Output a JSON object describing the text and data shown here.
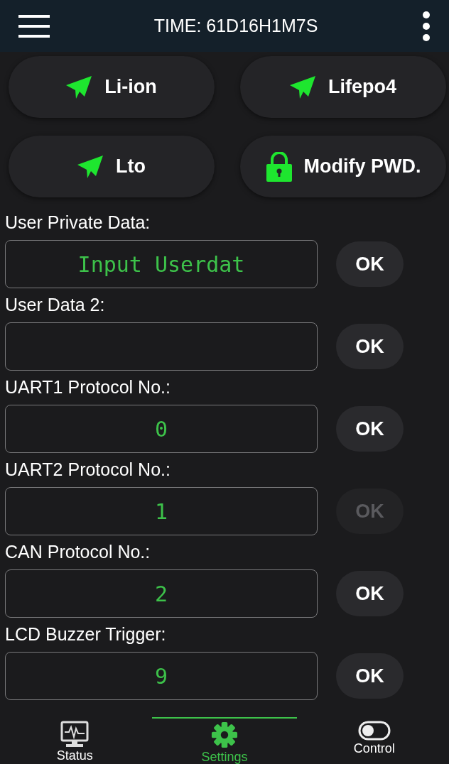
{
  "header": {
    "title": "TIME: 61D16H1M7S"
  },
  "presets": [
    {
      "label": "Li-ion",
      "kind": "plane"
    },
    {
      "label": "Lifepo4",
      "kind": "plane"
    },
    {
      "label": "Lto",
      "kind": "plane"
    },
    {
      "label": "Modify PWD.",
      "kind": "lock"
    }
  ],
  "settings": [
    {
      "label": "User Private Data:",
      "value": "Input Userdat",
      "button": "OK",
      "disabled": false
    },
    {
      "label": "User Data 2:",
      "button": "OK",
      "disabled": false
    },
    {
      "label": "UART1 Protocol No.:",
      "value": "0",
      "button": "OK",
      "disabled": false
    },
    {
      "label": "UART2 Protocol No.:",
      "value": "1",
      "button": "OK",
      "disabled": true
    },
    {
      "label": "CAN Protocol No.:",
      "value": "2",
      "button": "OK",
      "disabled": false
    },
    {
      "label": "LCD Buzzer Trigger:",
      "value": "9",
      "button": "OK",
      "disabled": false
    }
  ],
  "nav": [
    {
      "label": "Status",
      "kind": "monitor",
      "selected": false
    },
    {
      "label": "Settings",
      "kind": "gear",
      "selected": true
    },
    {
      "label": "Control",
      "kind": "toggle",
      "selected": false
    }
  ]
}
